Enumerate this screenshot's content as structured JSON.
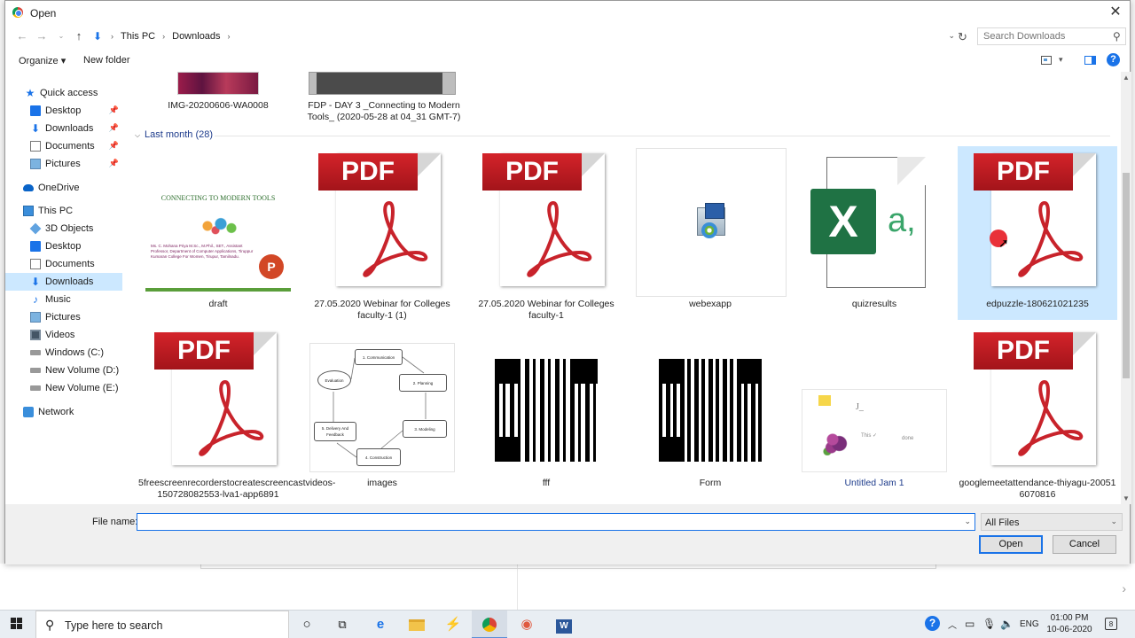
{
  "dialog": {
    "title": "Open",
    "close_symbol": "✕",
    "address": {
      "breadcrumbs": [
        "This PC",
        "Downloads"
      ],
      "search_placeholder": "Search Downloads"
    },
    "toolbar": {
      "organize_label": "Organize ▾",
      "new_folder_label": "New folder"
    },
    "nav": {
      "items": [
        {
          "label": "Quick access",
          "icon": "star-icon"
        },
        {
          "label": "Desktop",
          "icon": "desktop-icon"
        },
        {
          "label": "Downloads",
          "icon": "downloads-icon"
        },
        {
          "label": "Documents",
          "icon": "documents-icon"
        },
        {
          "label": "Pictures",
          "icon": "pictures-icon"
        },
        {
          "label": "OneDrive",
          "icon": "cloud-icon"
        },
        {
          "label": "This PC",
          "icon": "computer-icon"
        },
        {
          "label": "3D Objects",
          "icon": "cube-icon"
        },
        {
          "label": "Desktop",
          "icon": "desktop-icon"
        },
        {
          "label": "Documents",
          "icon": "documents-icon"
        },
        {
          "label": "Downloads",
          "icon": "downloads-icon"
        },
        {
          "label": "Music",
          "icon": "music-icon"
        },
        {
          "label": "Pictures",
          "icon": "pictures-icon"
        },
        {
          "label": "Videos",
          "icon": "video-icon"
        },
        {
          "label": "Windows (C:)",
          "icon": "drive-icon"
        },
        {
          "label": "New Volume (D:)",
          "icon": "drive-icon"
        },
        {
          "label": "New Volume (E:)",
          "icon": "drive-icon"
        },
        {
          "label": "Network",
          "icon": "network-icon"
        }
      ]
    },
    "content": {
      "top_row": [
        {
          "name": "IMG-20200606-WA0008"
        },
        {
          "name": "FDP - DAY 3 _Connecting to Modern Tools_ (2020-05-28 at 04_31 GMT-7)"
        }
      ],
      "group_label": "Last month (28)",
      "pdf_banner": "PDF",
      "row1": [
        {
          "name": "draft",
          "type": "ppt",
          "slide_title": "CONNECTING TO MODERN TOOLS",
          "slide_text": "Ms. C. Mohana Priya M.Sc., M.Phil., SET., Assistant Professor, Department of Computer Applications, Tiruppur Kumaran College For Women, Tirupur, Tamilnadu."
        },
        {
          "name": "27.05.2020 Webinar for Colleges faculty-1 (1)",
          "type": "pdf"
        },
        {
          "name": "27.05.2020 Webinar for Colleges faculty-1",
          "type": "pdf"
        },
        {
          "name": "webexapp",
          "type": "installer"
        },
        {
          "name": "quizresults",
          "type": "excel",
          "excel_letter": "X",
          "excel_suffix": "a,"
        },
        {
          "name": "edpuzzle-180621021235",
          "type": "pdf"
        }
      ],
      "row2": [
        {
          "name": "5freescreenrecorderstocreatescreencastvideos-150728082553-lva1-app6891",
          "type": "pdf"
        },
        {
          "name": "images",
          "type": "diagram",
          "nodes": [
            "1. Communication",
            "2. Planning",
            "3. Modeling",
            "4. Construction",
            "5. Delivery And Feedback",
            "Evaluation"
          ]
        },
        {
          "name": "fff",
          "type": "qr"
        },
        {
          "name": "Form",
          "type": "qr"
        },
        {
          "name": "Untitled Jam 1",
          "type": "jam",
          "scribbles": [
            "J_",
            "This ✓",
            "done"
          ]
        },
        {
          "name": "googlemeetattendance-thiyagu-20051 6070816",
          "type": "pdf"
        }
      ]
    },
    "bottom": {
      "file_name_label": "File name:",
      "file_name_value": "",
      "file_type": "All Files",
      "open_label": "Open",
      "cancel_label": "Cancel"
    }
  },
  "taskbar": {
    "search_placeholder": "Type here to search",
    "language": "ENG",
    "time": "01:00 PM",
    "date": "10-06-2020",
    "notification_count": "8"
  }
}
